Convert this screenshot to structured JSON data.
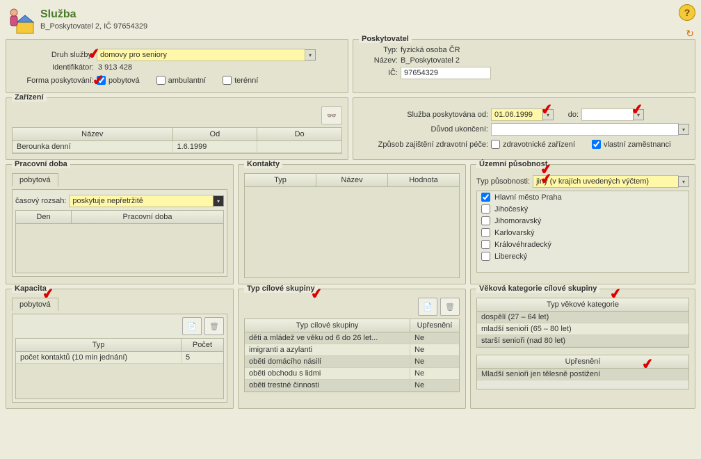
{
  "header": {
    "title": "Služba",
    "subtitle": "B_Poskytovatel 2, IČ 97654329"
  },
  "druh_sluzby": {
    "label": "Druh služby:",
    "value": "domovy pro seniory",
    "ident_label": "Identifikátor:",
    "ident_value": "3 913 428",
    "forma_label": "Forma poskytování:",
    "pobytova": "pobytová",
    "ambulantni": "ambulantní",
    "terenni": "terénní"
  },
  "poskytovatel": {
    "legend": "Poskytovatel",
    "typ_label": "Typ:",
    "typ_value": "fyzická osoba ČR",
    "nazev_label": "Název:",
    "nazev_value": "B_Poskytovatel 2",
    "ic_label": "IČ:",
    "ic_value": "97654329"
  },
  "sluzba_od": {
    "od_label": "Služba poskytována od:",
    "od_value": "01.06.1999",
    "do_label": "do:",
    "do_value": "",
    "duvod_label": "Důvod ukončení:",
    "zpusob_label": "Způsob zajištění zdravotní péče:",
    "zdravot_zarizeni": "zdravotnické zařízení",
    "vlastni_zam": "vlastní zaměstnanci"
  },
  "zarizeni": {
    "legend": "Zařízení",
    "cols": {
      "nazev": "Název",
      "od": "Od",
      "do": "Do"
    },
    "rows": [
      {
        "nazev": "Berounka denní",
        "od": "1.6.1999",
        "do": ""
      }
    ]
  },
  "pracovni_doba": {
    "legend": "Pracovní doba",
    "tab": "pobytová",
    "rozsah_label": "časový rozsah:",
    "rozsah_value": "poskytuje nepřetržitě",
    "cols": {
      "den": "Den",
      "doba": "Pracovní doba"
    }
  },
  "kontakty": {
    "legend": "Kontakty",
    "cols": {
      "typ": "Typ",
      "nazev": "Název",
      "hodnota": "Hodnota"
    }
  },
  "uzemni": {
    "legend": "Územní působnost",
    "typ_label": "Typ působnosti:",
    "typ_value": "jiný (v krajích uvedených výčtem)",
    "regions": [
      {
        "name": "Hlavní město Praha",
        "checked": true
      },
      {
        "name": "Jihočeský",
        "checked": false
      },
      {
        "name": "Jihomoravský",
        "checked": false
      },
      {
        "name": "Karlovarský",
        "checked": false
      },
      {
        "name": "Královéhradecký",
        "checked": false
      },
      {
        "name": "Liberecký",
        "checked": false
      }
    ]
  },
  "kapacita": {
    "legend": "Kapacita",
    "tab": "pobytová",
    "cols": {
      "typ": "Typ",
      "pocet": "Počet"
    },
    "rows": [
      {
        "typ": "počet kontaktů (10 min jednání)",
        "pocet": "5"
      }
    ]
  },
  "cilova": {
    "legend": "Typ cílové skupiny",
    "cols": {
      "typ": "Typ cílové skupiny",
      "upresneni": "Upřesnění"
    },
    "rows": [
      {
        "typ": "děti a mládež ve věku od 6 do 26 let...",
        "upr": "Ne"
      },
      {
        "typ": "imigranti a azylanti",
        "upr": "Ne"
      },
      {
        "typ": "oběti domácího násilí",
        "upr": "Ne"
      },
      {
        "typ": "oběti obchodu s lidmi",
        "upr": "Ne"
      },
      {
        "typ": "oběti trestné činnosti",
        "upr": "Ne"
      }
    ]
  },
  "vekova": {
    "legend": "Věková kategorie cílové skupiny",
    "col1": "Typ věkové kategorie",
    "rows": [
      "dospělí (27 – 64 let)",
      "mladší senioři (65 – 80 let)",
      "starší senioři (nad 80 let)"
    ],
    "col2": "Upřesnění",
    "upresneni_rows": [
      "Mladší senioři jen tělesně postižení"
    ]
  }
}
